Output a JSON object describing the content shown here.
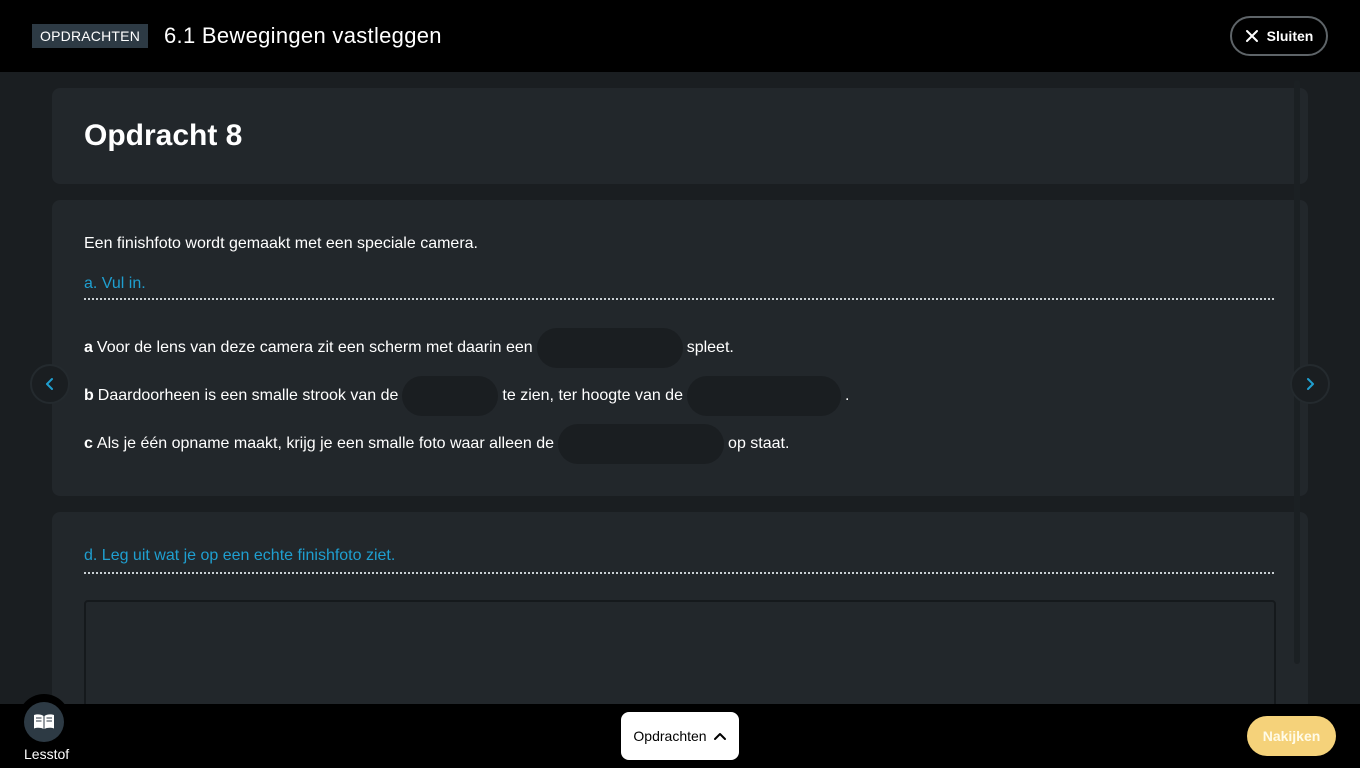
{
  "header": {
    "badge": "OPDRACHTEN",
    "title": "6.1  Bewegingen vastleggen",
    "close_label": "Sluiten"
  },
  "assignment": {
    "title": "Opdracht 8"
  },
  "question": {
    "intro": "Een finishfoto wordt gemaakt met een speciale camera.",
    "section_a_label": "a. Vul in.",
    "lines": [
      {
        "letter": "a",
        "before": "Voor de lens van deze camera zit een scherm met daarin een",
        "after": "spleet."
      },
      {
        "letter": "b",
        "before": "Daardoorheen is een smalle strook van de",
        "middle": "te zien, ter hoogte van de",
        "after": "."
      },
      {
        "letter": "c",
        "before": "Als je één opname maakt, krijg je een smalle foto waar alleen de",
        "after": "op staat."
      }
    ]
  },
  "question_d": {
    "label": "d. Leg uit wat je op een echte finishfoto ziet."
  },
  "bottom": {
    "lesstof_label": "Lesstof",
    "opdrachten_label": "Opdrachten",
    "nakijken_label": "Nakijken"
  },
  "colors": {
    "accent": "#1f9fd0",
    "nakijken_bg": "#f5d27a"
  }
}
